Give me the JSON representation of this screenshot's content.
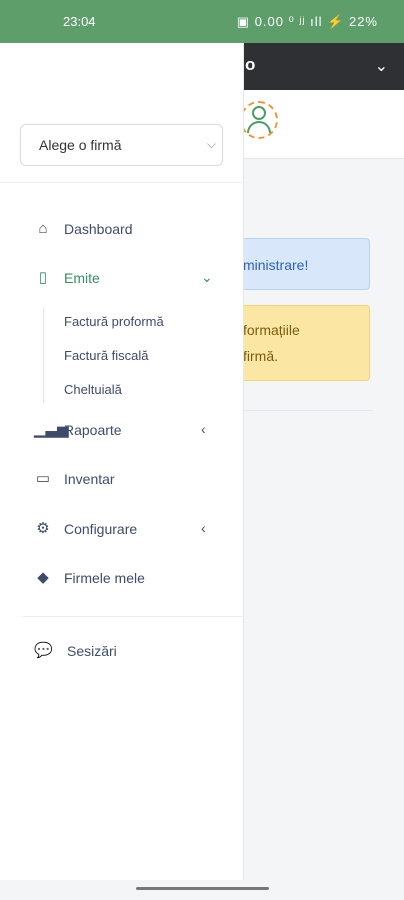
{
  "status_bar": {
    "time": "23:04",
    "icons": "▣ 0.00 ⁰ ʲʲ ıll ⚡ 22%",
    "battery": "22%"
  },
  "background": {
    "header_title_fragment": "o",
    "alert_info": "ministrare!",
    "alert_warning": {
      "line1": "formațiile",
      "line2": "firmă."
    }
  },
  "drawer": {
    "company_select": {
      "value": "Alege o firmă"
    },
    "menu": [
      {
        "key": "dashboard",
        "label": "Dashboard",
        "icon": "home-icon"
      },
      {
        "key": "emite",
        "label": "Emite",
        "icon": "document-icon",
        "active": true,
        "chevron": "down"
      },
      {
        "key": "rapoarte",
        "label": "Rapoarte",
        "icon": "bar-chart-icon",
        "chevron": "left"
      },
      {
        "key": "inventar",
        "label": "Inventar",
        "icon": "inbox-icon"
      },
      {
        "key": "configurare",
        "label": "Configurare",
        "icon": "gears-icon",
        "chevron": "left"
      },
      {
        "key": "firmele_mele",
        "label": "Firmele mele",
        "icon": "layers-icon"
      }
    ],
    "submenu": [
      "Factură proformă",
      "Factură fiscală",
      "Cheltuială"
    ],
    "feedback": {
      "label": "Sesizări",
      "icon": "chat-icon"
    }
  },
  "colors": {
    "status_bar": "#5e9e6b",
    "active": "#3a8d62",
    "text": "#3f4b6a"
  }
}
